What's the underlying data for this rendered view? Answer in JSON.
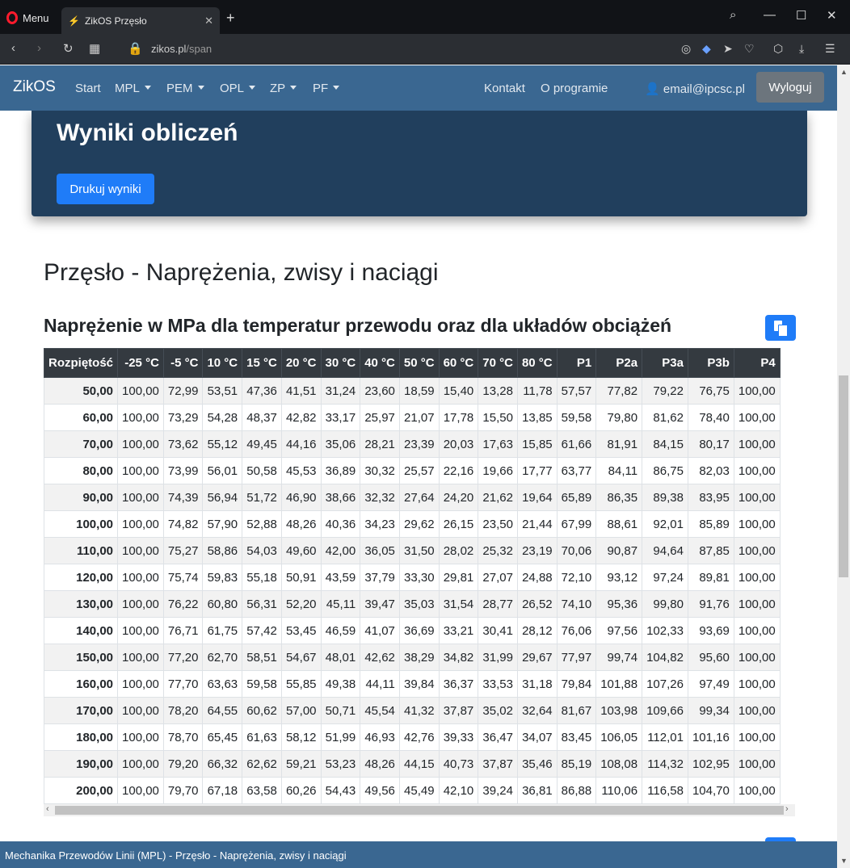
{
  "browser": {
    "menu_label": "Menu",
    "tab_title": "ZikOS Przęsło",
    "tab_close": "✕",
    "new_tab": "+",
    "url_host": "zikos.pl",
    "url_path": "/span"
  },
  "navbar": {
    "brand": "ZikOS",
    "items": [
      "Start",
      "MPL",
      "PEM",
      "OPL",
      "ZP",
      "PF"
    ],
    "contact": "Kontakt",
    "about": "O programie",
    "user": "email@ipcsc.pl",
    "logout": "Wyloguj"
  },
  "jumbotron": {
    "title": "Wyniki obliczeń",
    "print_button": "Drukuj wyniki"
  },
  "page": {
    "title": "Przęsło - Naprężenia, zwisy i naciągi",
    "section_title": "Naprężenie w MPa dla temperatur przewodu oraz dla układów obciążeń"
  },
  "table": {
    "headers": [
      "Rozpiętość",
      "-25 °C",
      "-5 °C",
      "10 °C",
      "15 °C",
      "20 °C",
      "30 °C",
      "40 °C",
      "50 °C",
      "60 °C",
      "70 °C",
      "80 °C",
      "P1",
      "P2a",
      "P3a",
      "P3b",
      "P4"
    ],
    "rows": [
      [
        "50,00",
        "100,00",
        "72,99",
        "53,51",
        "47,36",
        "41,51",
        "31,24",
        "23,60",
        "18,59",
        "15,40",
        "13,28",
        "11,78",
        "57,57",
        "77,82",
        "79,22",
        "76,75",
        "100,00"
      ],
      [
        "60,00",
        "100,00",
        "73,29",
        "54,28",
        "48,37",
        "42,82",
        "33,17",
        "25,97",
        "21,07",
        "17,78",
        "15,50",
        "13,85",
        "59,58",
        "79,80",
        "81,62",
        "78,40",
        "100,00"
      ],
      [
        "70,00",
        "100,00",
        "73,62",
        "55,12",
        "49,45",
        "44,16",
        "35,06",
        "28,21",
        "23,39",
        "20,03",
        "17,63",
        "15,85",
        "61,66",
        "81,91",
        "84,15",
        "80,17",
        "100,00"
      ],
      [
        "80,00",
        "100,00",
        "73,99",
        "56,01",
        "50,58",
        "45,53",
        "36,89",
        "30,32",
        "25,57",
        "22,16",
        "19,66",
        "17,77",
        "63,77",
        "84,11",
        "86,75",
        "82,03",
        "100,00"
      ],
      [
        "90,00",
        "100,00",
        "74,39",
        "56,94",
        "51,72",
        "46,90",
        "38,66",
        "32,32",
        "27,64",
        "24,20",
        "21,62",
        "19,64",
        "65,89",
        "86,35",
        "89,38",
        "83,95",
        "100,00"
      ],
      [
        "100,00",
        "100,00",
        "74,82",
        "57,90",
        "52,88",
        "48,26",
        "40,36",
        "34,23",
        "29,62",
        "26,15",
        "23,50",
        "21,44",
        "67,99",
        "88,61",
        "92,01",
        "85,89",
        "100,00"
      ],
      [
        "110,00",
        "100,00",
        "75,27",
        "58,86",
        "54,03",
        "49,60",
        "42,00",
        "36,05",
        "31,50",
        "28,02",
        "25,32",
        "23,19",
        "70,06",
        "90,87",
        "94,64",
        "87,85",
        "100,00"
      ],
      [
        "120,00",
        "100,00",
        "75,74",
        "59,83",
        "55,18",
        "50,91",
        "43,59",
        "37,79",
        "33,30",
        "29,81",
        "27,07",
        "24,88",
        "72,10",
        "93,12",
        "97,24",
        "89,81",
        "100,00"
      ],
      [
        "130,00",
        "100,00",
        "76,22",
        "60,80",
        "56,31",
        "52,20",
        "45,11",
        "39,47",
        "35,03",
        "31,54",
        "28,77",
        "26,52",
        "74,10",
        "95,36",
        "99,80",
        "91,76",
        "100,00"
      ],
      [
        "140,00",
        "100,00",
        "76,71",
        "61,75",
        "57,42",
        "53,45",
        "46,59",
        "41,07",
        "36,69",
        "33,21",
        "30,41",
        "28,12",
        "76,06",
        "97,56",
        "102,33",
        "93,69",
        "100,00"
      ],
      [
        "150,00",
        "100,00",
        "77,20",
        "62,70",
        "58,51",
        "54,67",
        "48,01",
        "42,62",
        "38,29",
        "34,82",
        "31,99",
        "29,67",
        "77,97",
        "99,74",
        "104,82",
        "95,60",
        "100,00"
      ],
      [
        "160,00",
        "100,00",
        "77,70",
        "63,63",
        "59,58",
        "55,85",
        "49,38",
        "44,11",
        "39,84",
        "36,37",
        "33,53",
        "31,18",
        "79,84",
        "101,88",
        "107,26",
        "97,49",
        "100,00"
      ],
      [
        "170,00",
        "100,00",
        "78,20",
        "64,55",
        "60,62",
        "57,00",
        "50,71",
        "45,54",
        "41,32",
        "37,87",
        "35,02",
        "32,64",
        "81,67",
        "103,98",
        "109,66",
        "99,34",
        "100,00"
      ],
      [
        "180,00",
        "100,00",
        "78,70",
        "65,45",
        "61,63",
        "58,12",
        "51,99",
        "46,93",
        "42,76",
        "39,33",
        "36,47",
        "34,07",
        "83,45",
        "106,05",
        "112,01",
        "101,16",
        "100,00"
      ],
      [
        "190,00",
        "100,00",
        "79,20",
        "66,32",
        "62,62",
        "59,21",
        "53,23",
        "48,26",
        "44,15",
        "40,73",
        "37,87",
        "35,46",
        "85,19",
        "108,08",
        "114,32",
        "102,95",
        "100,00"
      ],
      [
        "200,00",
        "100,00",
        "79,70",
        "67,18",
        "63,58",
        "60,26",
        "54,43",
        "49,56",
        "45,49",
        "42,10",
        "39,24",
        "36,81",
        "86,88",
        "110,06",
        "116,58",
        "104,70",
        "100,00"
      ]
    ]
  },
  "statusbar": {
    "text": "Mechanika Przewodów Linii (MPL) - Przęsło - Naprężenia, zwisy i naciągi"
  },
  "colors": {
    "navbar": "#3a6791",
    "jumbotron": "#213f5d",
    "primary": "#1f7cf8",
    "table_header": "#343a40"
  }
}
